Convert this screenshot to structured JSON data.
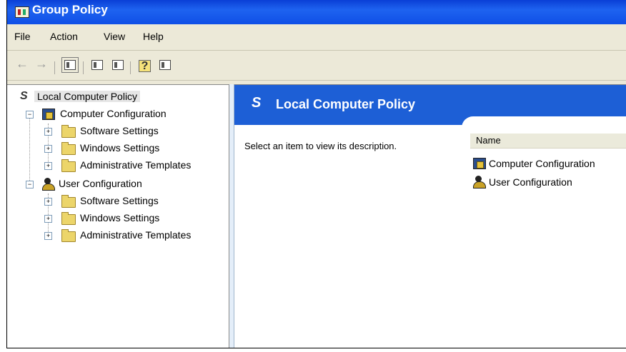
{
  "window": {
    "title": "Group Policy"
  },
  "menu": {
    "items": [
      "File",
      "Action",
      "View",
      "Help"
    ]
  },
  "toolbar": {
    "buttons": [
      "back-icon",
      "forward-icon",
      "show-hide-tree-icon",
      "properties-icon",
      "export-list-icon",
      "help-icon",
      "show-hide-action-pane-icon"
    ]
  },
  "tree": {
    "root": "Local Computer Policy",
    "nodes": [
      {
        "label": "Computer Configuration",
        "children": [
          "Software Settings",
          "Windows Settings",
          "Administrative Templates"
        ]
      },
      {
        "label": "User Configuration",
        "children": [
          "Software Settings",
          "Windows Settings",
          "Administrative Templates"
        ]
      }
    ]
  },
  "details": {
    "header_title": "Local Computer Policy",
    "description": "Select an item to view its description.",
    "column_name": "Name",
    "items": [
      "Computer Configuration",
      "User Configuration"
    ]
  },
  "colors": {
    "title_bar": "#0f4fe6",
    "header_band": "#1d5fd6",
    "folder": "#ecd56a",
    "chrome": "#ece9d8"
  }
}
